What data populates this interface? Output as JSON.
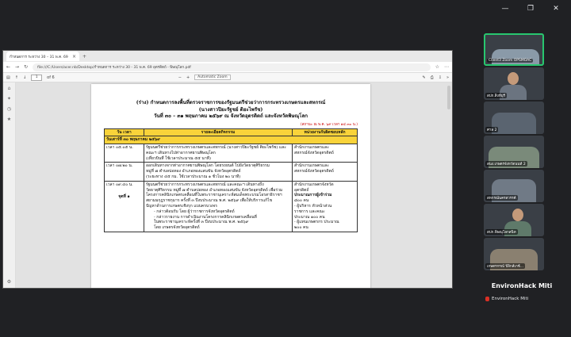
{
  "window": {
    "minimize": "—",
    "maximize": "❐",
    "close": "✕"
  },
  "browser": {
    "tab_title": "กำหนดการ ระหว่าง 30 – 31 พ.ค. 69 อุตรดิตถ์ - พิษณุโลก.pdf",
    "url": "file:///C:/Users/acer.nb/Desktop/กำหนดการ ระหว่าง 30 - 31 พ.ค. 69 อุตรดิตถ์ - พิษณุโลก.pdf",
    "page_current": "1",
    "page_total": "of 6",
    "zoom": "Automatic Zoom"
  },
  "doc": {
    "title1": "(ร่าง) กำหนดการลงพื้นที่ตรวจราชการของรัฐมนตรีช่วยว่าการกระทรวงเกษตรและสหกรณ์",
    "title2": "(นางสาวปิยะรัฐชย์ ติยะไพรัช)",
    "title3": "วันที่ ๓๐ – ๓๑ พฤษภาคม ๒๕๖๙ ณ จังหวัดอุตรดิตถ์ และจังหวัดพิษณุโลก",
    "note": "(สถานะ ณ พ.ค. ๖๙ เวลา ๑๔.๓๐ น.)",
    "headers": [
      "วัน เวลา",
      "รายละเอียดกิจกรรม",
      "หน่วยงานรับผิดชอบหลัก"
    ],
    "day_row": "วันเสาร์ที่ ๓๐ พฤษภาคม ๒๕๖๙",
    "rows": [
      {
        "time": "เวลา ๐๕.๐๕ น.",
        "detail1": "รัฐมนตรีช่วยว่าการกระทรวงเกษตรและสหกรณ์ (นางสาวปิยะรัฐชย์ ติยะไพรัช) และ",
        "detail2": "คณะฯ เดินทางไปท่าอากาศยานพิษณุโลก",
        "detail3": "(เที่ยวบินที่ ใช้เวลาประมาณ ๕๕ นาที)",
        "unit1": "สำนักงานเกษตรและ",
        "unit2": "สหกรณ์จังหวัดอุตรดิตถ์"
      },
      {
        "time": "เวลา ๐๗.๒๐ น.",
        "detail1": "ออกเดินทางจากท่าอากาศยานพิษณุโลก โดยรถยนต์ ไปยังวัดธาตุศิริธรรม",
        "detail2": "หมู่ที่ ๗ ตำบลบ่อทอง อำเภอทองแสนขัน จังหวัดอุตรดิตถ์",
        "detail3": "(ระยะทาง ๔๕ กม. ใช้เวลาประมาณ ๑ ชั่วโมง ๒๐ นาที)",
        "unit1": "สำนักงานเกษตรและ",
        "unit2": "สหกรณ์จังหวัดอุตรดิตถ์"
      },
      {
        "time": "เวลา ๐๙.๔๐ น.",
        "point": "จุดที่ ๑",
        "detail1": "รัฐมนตรีช่วยว่าการกระทรวงเกษตรและสหกรณ์ และคณะฯ เดินทางถึง",
        "detail2": "วัดธาตุศิริธรรม หมู่ที่ ๗ ตำบลบ่อทอง อำเภอทองแสนขัน จังหวัดอุตรดิตถ์ เพื่อร่วม",
        "detail3": "โครงการคลินิกเกษตรเคลื่อนที่ในพระราชานุเคราะห์สมเด็จพระบรมโอรสาธิราชฯ",
        "detail4": "สยามมกุฎราชกุมาร ครั้งที่ ๓ ปีงบประมาณ พ.ศ. ๒๕๖๙ เพื่อให้บริการแก้ไข",
        "detail5": "ปัญหาด้านการเกษตรเชิงรุก แบบครบวงจร",
        "bullet1": "- กล่าวต้อนรับ โดย ผู้ว่าราชการจังหวัดอุตรดิตถ์",
        "bullet2": "- กล่าวรายงาน การดำเนินงานโครงการคลินิกเกษตรเคลื่อนที่",
        "bullet3": "ในพระราชานุเคราะห์ครั้งที่ ๓ ปีงบประมาณ พ.ศ. ๒๕๖๙",
        "bullet4": "โดย เกษตรจังหวัดอุตรดิตถ์",
        "unit1": "สำนักงานเกษตรจังหวัด",
        "unit2": "อุตรดิตถ์",
        "unit3": "ประมาณการผู้เข้าร่วม",
        "unit4": "๘๐๐ คน",
        "unit5": "- ผู้บริหาร หัวหน้าส่วน",
        "unit6": "ราชการ และคณะ",
        "unit7": "ประมาณ ๑๐๐ คน",
        "unit8": "- ผู้แทนเกษตรกร ประมาณ",
        "unit9": "๒๐๐ คน"
      }
    ]
  },
  "participants": [
    {
      "name": "Client3 Zoom OPSMOAC",
      "color": "#8a9aa8",
      "active": true
    },
    {
      "name": "สปก.สิงห์บุรี",
      "color": "#6b7480"
    },
    {
      "name": "ศาล 2",
      "color": "#5a6470"
    },
    {
      "name": "สนง.เกษตรจังหวัดนนท์ 2",
      "color": "#7a8a7a"
    },
    {
      "name": "สหกรณ์นครสวรรค์",
      "color": "#707a86"
    },
    {
      "name": "สปก.พิษณุโลกสนิท",
      "color": "#5f7a6a"
    },
    {
      "name": "เกษตรกรณ์ ปีลิกส์เกช์...",
      "color": "#8a8070"
    }
  ],
  "active_speaker": "EnvironHack Miti",
  "active_speaker_small": "EnvironHack Miti"
}
